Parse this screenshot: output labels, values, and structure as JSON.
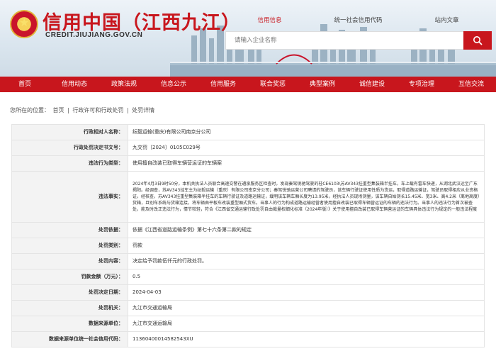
{
  "header": {
    "title_cn": "信用中国（江西九江）",
    "title_en": "CREDIT.JIUJIANG.GOV.CN",
    "tabs": [
      "信用信息",
      "统一社会信用代码",
      "站内文章"
    ],
    "search_placeholder": "请输入企业名称"
  },
  "nav": [
    "首页",
    "信用动态",
    "政策法规",
    "信息公示",
    "信用服务",
    "联合奖惩",
    "典型案例",
    "诚信建设",
    "专项治理",
    "互信交流"
  ],
  "breadcrumb": [
    "您所在的位置：",
    "首页",
    "|",
    "行政许可和行政处罚",
    "|",
    "处罚详情"
  ],
  "details": [
    {
      "label": "行政相对人名称：",
      "value": "纭毅运输(重庆)有限公司南京分公司"
    },
    {
      "label": "行政处罚决定书文号：",
      "value": "九交罚〔2024〕0105C029号"
    },
    {
      "label": "违法行为类型：",
      "value": "使用擅自改装已取得车辆营运证的车辆案"
    },
    {
      "label": "违法事实：",
      "value": "2024年4月3日9时50分，本机关执法人员联合高速交警在通泉服务区检查时，发现秦驾锐驰驾驶的桂CE6103\\苏AV343挂重型集装箱半挂车，车上载有雷车快递，从湖北武汉运至广东揭阳。经调查，苏AV343挂车主为纭毅运输（重庆）有限公司南京分公司；秦驾锐驰运营公司聘请的驾驶员，该车辆行驶证使用性质为货运，取得道路运输证，驾驶员取得相应从业资格证。经核查，苏AV343挂重型集装箱半挂车的车辆行驶证及道路运输证，载明该车辆车厢长度为13.95米，经执法人员现场测量，该车辆自始测长15.45米、宽3米、高4.2米（离地高度）货箱，且别车系统与货箱连接，将车辆由平板车改装重型厢式货车。当事人的行为构成道路运输经营者使用擅自改装已取得车辆营运证的车辆的违法行为。当事人的违法行为首次被查处，能及时改正违法行为，情节较轻，符合《江西省交通运输行政处罚自由裁量权细化标准（2024年版）》关于使用擅自改装已取得车辆营运证的车辆具体违法行为规定的一般违法程度"
    },
    {
      "label": "处罚依据：",
      "value": "依据《江西省道路运输条例》第七十六条第二款的规定"
    },
    {
      "label": "处罚类别：",
      "value": "罚款"
    },
    {
      "label": "处罚内容：",
      "value": "决定给予罚款伍仟元的行政处罚。"
    },
    {
      "label": "罚款金额（万元）：",
      "value": "0.5"
    },
    {
      "label": "处罚决定日期：",
      "value": "2024-04-03"
    },
    {
      "label": "处罚机关：",
      "value": "九江市交通运输局"
    },
    {
      "label": "数据来源单位：",
      "value": "九江市交通运输局"
    },
    {
      "label": "数据来源单位统一社会信用代码：",
      "value": "11360400014582543XU"
    }
  ]
}
